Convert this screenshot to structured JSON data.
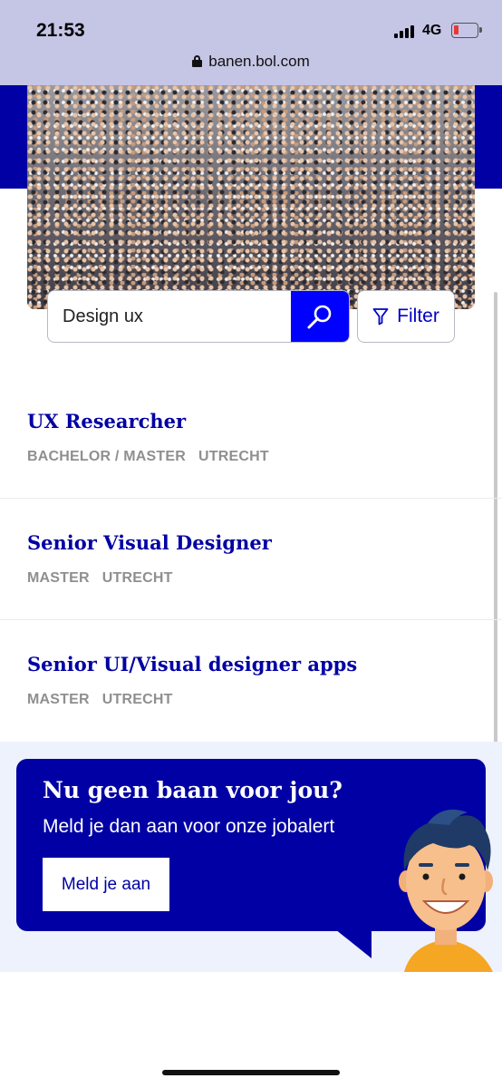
{
  "status_bar": {
    "time": "21:53",
    "network": "4G"
  },
  "browser": {
    "url": "banen.bol.com"
  },
  "search": {
    "value": "Design ux",
    "filter_label": "Filter"
  },
  "jobs": [
    {
      "title": "UX Researcher",
      "tags": [
        "BACHELOR / MASTER",
        "UTRECHT"
      ]
    },
    {
      "title": "Senior Visual Designer",
      "tags": [
        "MASTER",
        "UTRECHT"
      ]
    },
    {
      "title": "Senior UI/Visual designer apps",
      "tags": [
        "MASTER",
        "UTRECHT"
      ]
    }
  ],
  "job_alert": {
    "title": "Nu geen baan voor jou?",
    "subtitle": "Meld je dan aan voor onze jobalert",
    "button_label": "Meld je aan"
  },
  "colors": {
    "brand_blue": "#0000a4",
    "search_blue": "#0000ff",
    "tag_gray": "#8f8f8f",
    "alert_bg": "#eef2fc"
  }
}
